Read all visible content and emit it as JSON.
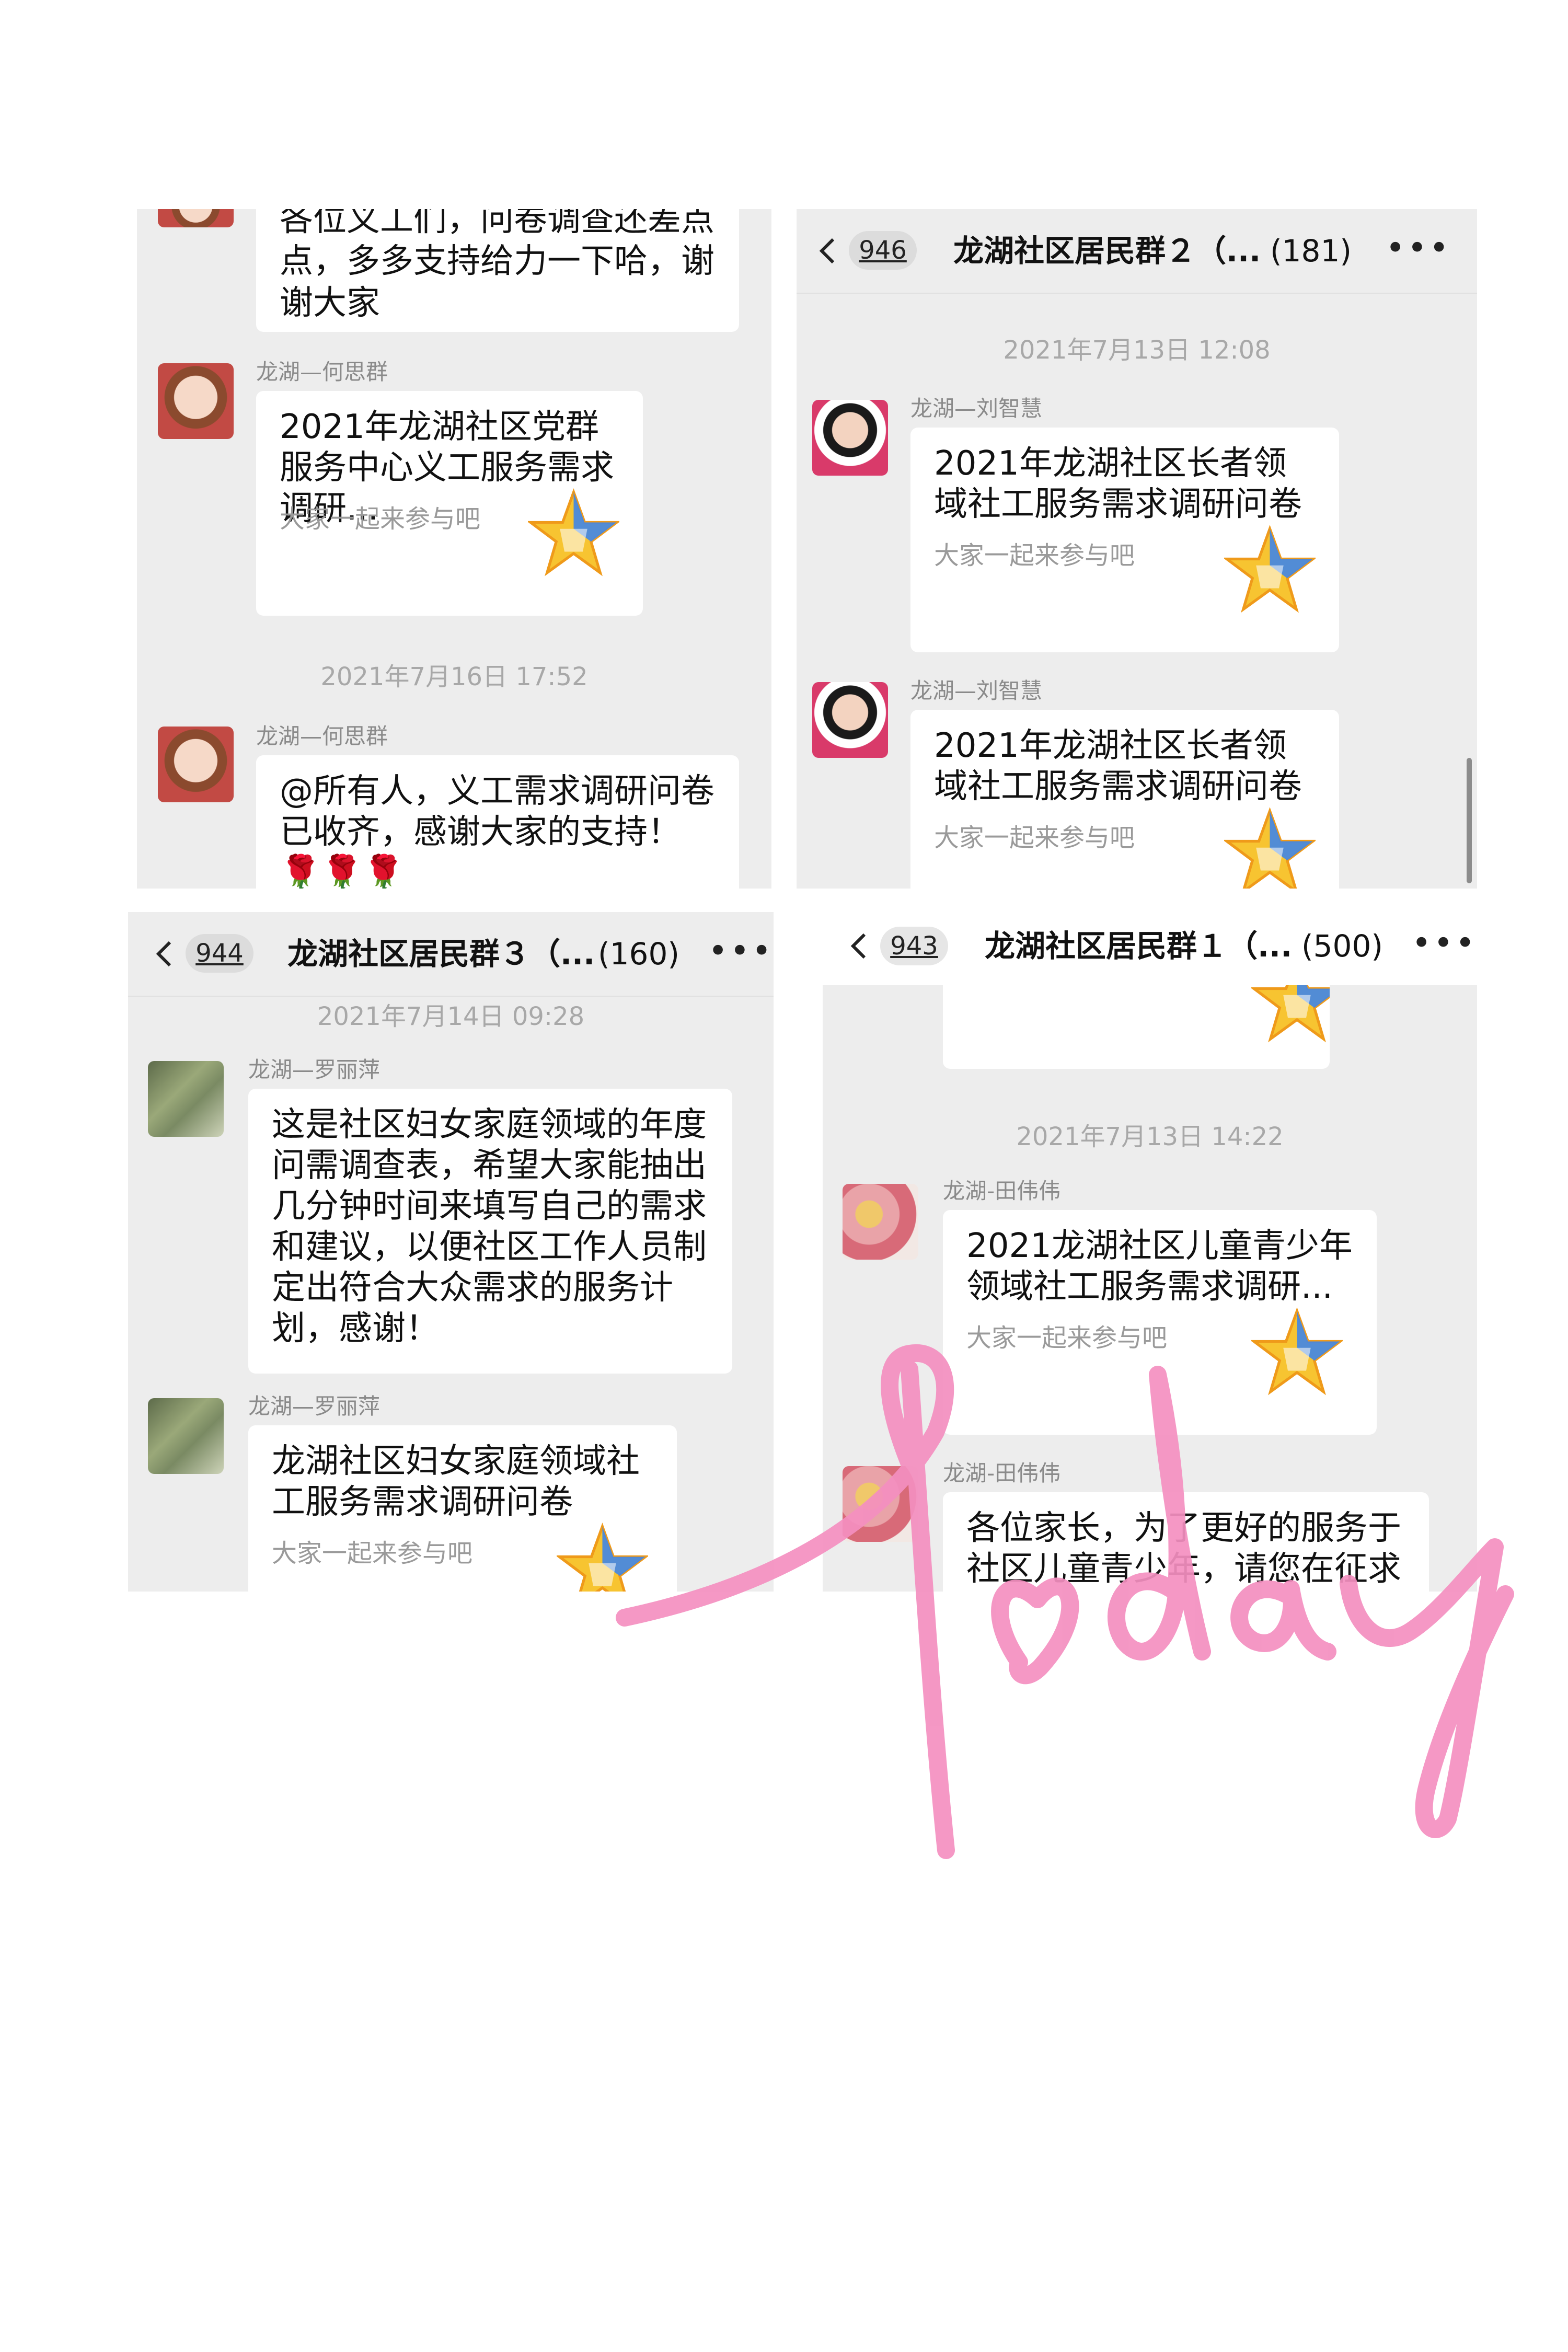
{
  "panel_tl": {
    "top_msg_text": "各位义工们，问卷调查还差点点，多多支持给力一下哈，谢谢大家",
    "msg1_sender": "龙湖—何思群",
    "msg1_title": "2021年龙湖社区党群服务中心义工服务需求调研...",
    "msg1_sub": "大家一起来参与吧",
    "timestamp": "2021年7月16日 17:52",
    "msg2_sender": "龙湖—何思群",
    "msg2_text": "@所有人，义工需求调研问卷已收齐，感谢大家的支持！🌹🌹🌹"
  },
  "panel_tr": {
    "back_icon": "chevron-left-icon",
    "badge": "946",
    "title": "龙湖社区居民群２（...",
    "count": "(181)",
    "more_icon": "ellipsis-icon",
    "timestamp": "2021年7月13日 12:08",
    "msg1_sender": "龙湖—刘智慧",
    "msg1_title": "2021年龙湖社区长者领域社工服务需求调研问卷",
    "msg1_sub": "大家一起来参与吧",
    "msg2_sender": "龙湖—刘智慧",
    "msg2_title": "2021年龙湖社区长者领域社工服务需求调研问卷",
    "msg2_sub": "大家一起来参与吧"
  },
  "panel_bl": {
    "badge": "944",
    "title": "龙湖社区居民群３（...",
    "count": "(160)",
    "timestamp": "2021年7月14日 09:28",
    "msg1_sender": "龙湖—罗丽萍",
    "msg1_text": "这是社区妇女家庭领域的年度问需调查表，希望大家能抽出几分钟时间来填写自己的需求和建议，以便社区工作人员制定出符合大众需求的服务计划，感谢！",
    "msg2_sender": "龙湖—罗丽萍",
    "msg2_title": "龙湖社区妇女家庭领域社工服务需求调研问卷",
    "msg2_sub": "大家一起来参与吧"
  },
  "panel_br": {
    "badge": "943",
    "title": "龙湖社区居民群１（...",
    "count": "(500)",
    "timestamp": "2021年7月13日 14:22",
    "msg1_sender": "龙湖-田伟伟",
    "msg1_title": "2021龙湖社区儿童青少年领域社工服务需求调研...",
    "msg1_sub": "大家一起来参与吧",
    "msg2_sender": "龙湖-田伟伟",
    "msg2_text": "各位家长，为了更好的服务于社区儿童青少年，请您在征求"
  },
  "overlay": {
    "handwriting": "Today",
    "color": "#f48fc0"
  },
  "colors": {
    "panel_bg": "#ededed",
    "bubble_bg": "#ffffff",
    "timestamp": "#a8a8a8",
    "sender": "#8a8a8a"
  }
}
